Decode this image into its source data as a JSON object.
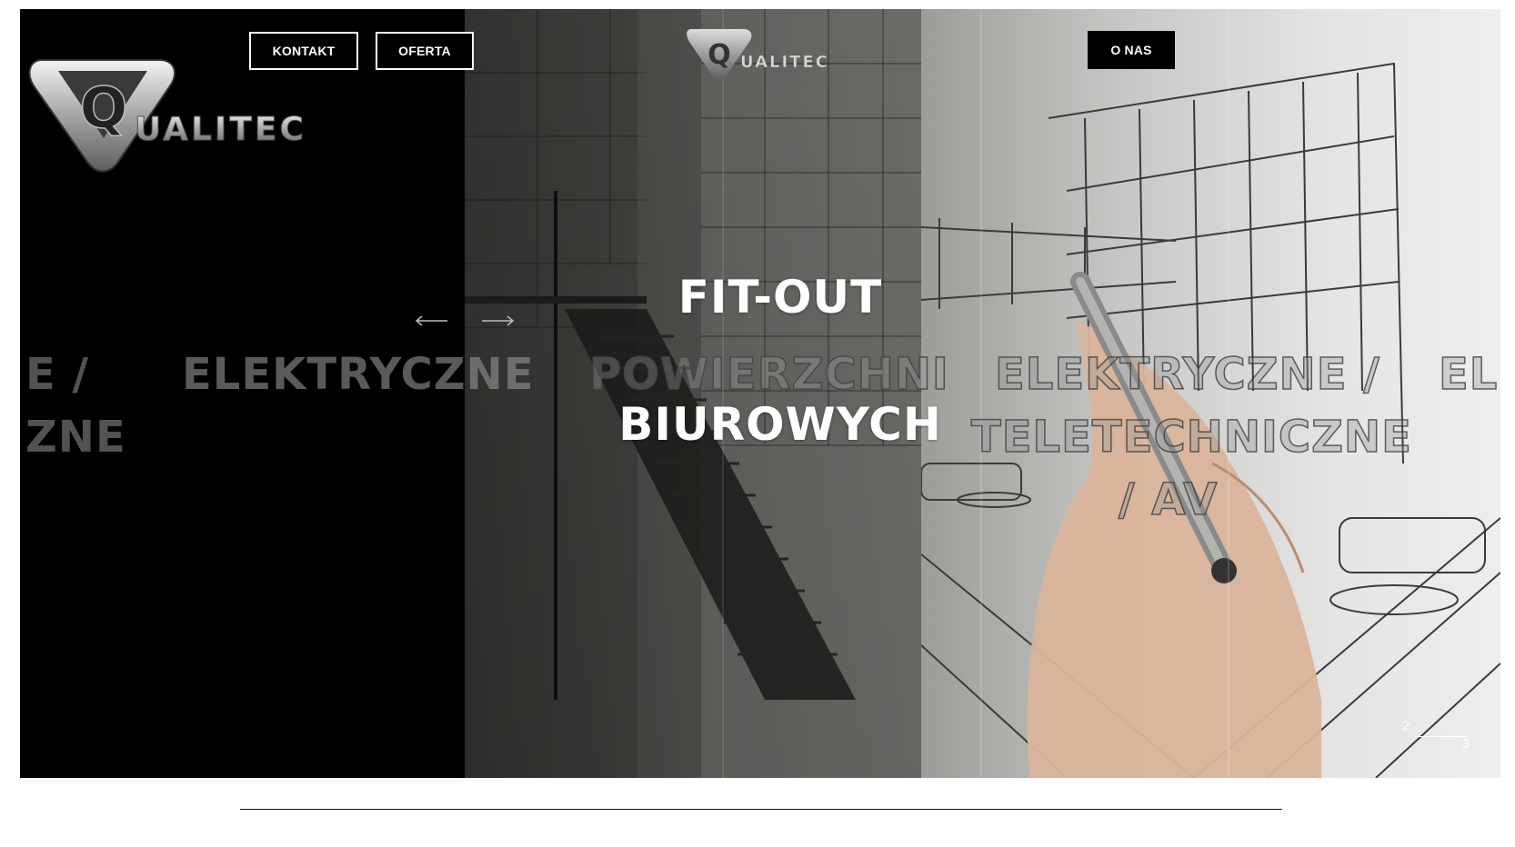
{
  "brand": {
    "logo_text": "UALITEC",
    "logo_letter": "Q"
  },
  "nav": {
    "kontakt": "KONTAKT",
    "oferta": "OFERTA",
    "o_nas": "O NAS"
  },
  "slider": {
    "headline_line1": "FIT-OUT",
    "headline_line2": "BIUROWYCH",
    "ghost_texts": [
      "E /",
      "ELEKTRYCZNE",
      "ZNE",
      "POWIERZCHNI",
      "ELEKTRYCZNE /",
      "TELETECHNICZNE",
      "/ AV",
      "EL"
    ],
    "pager_current": "2",
    "pager_total": "3"
  },
  "colors": {
    "background": "#000000",
    "button_border": "#ffffff",
    "headline": "#ffffff"
  },
  "icons": {
    "prev": "arrow-left-icon",
    "next": "arrow-right-icon"
  }
}
